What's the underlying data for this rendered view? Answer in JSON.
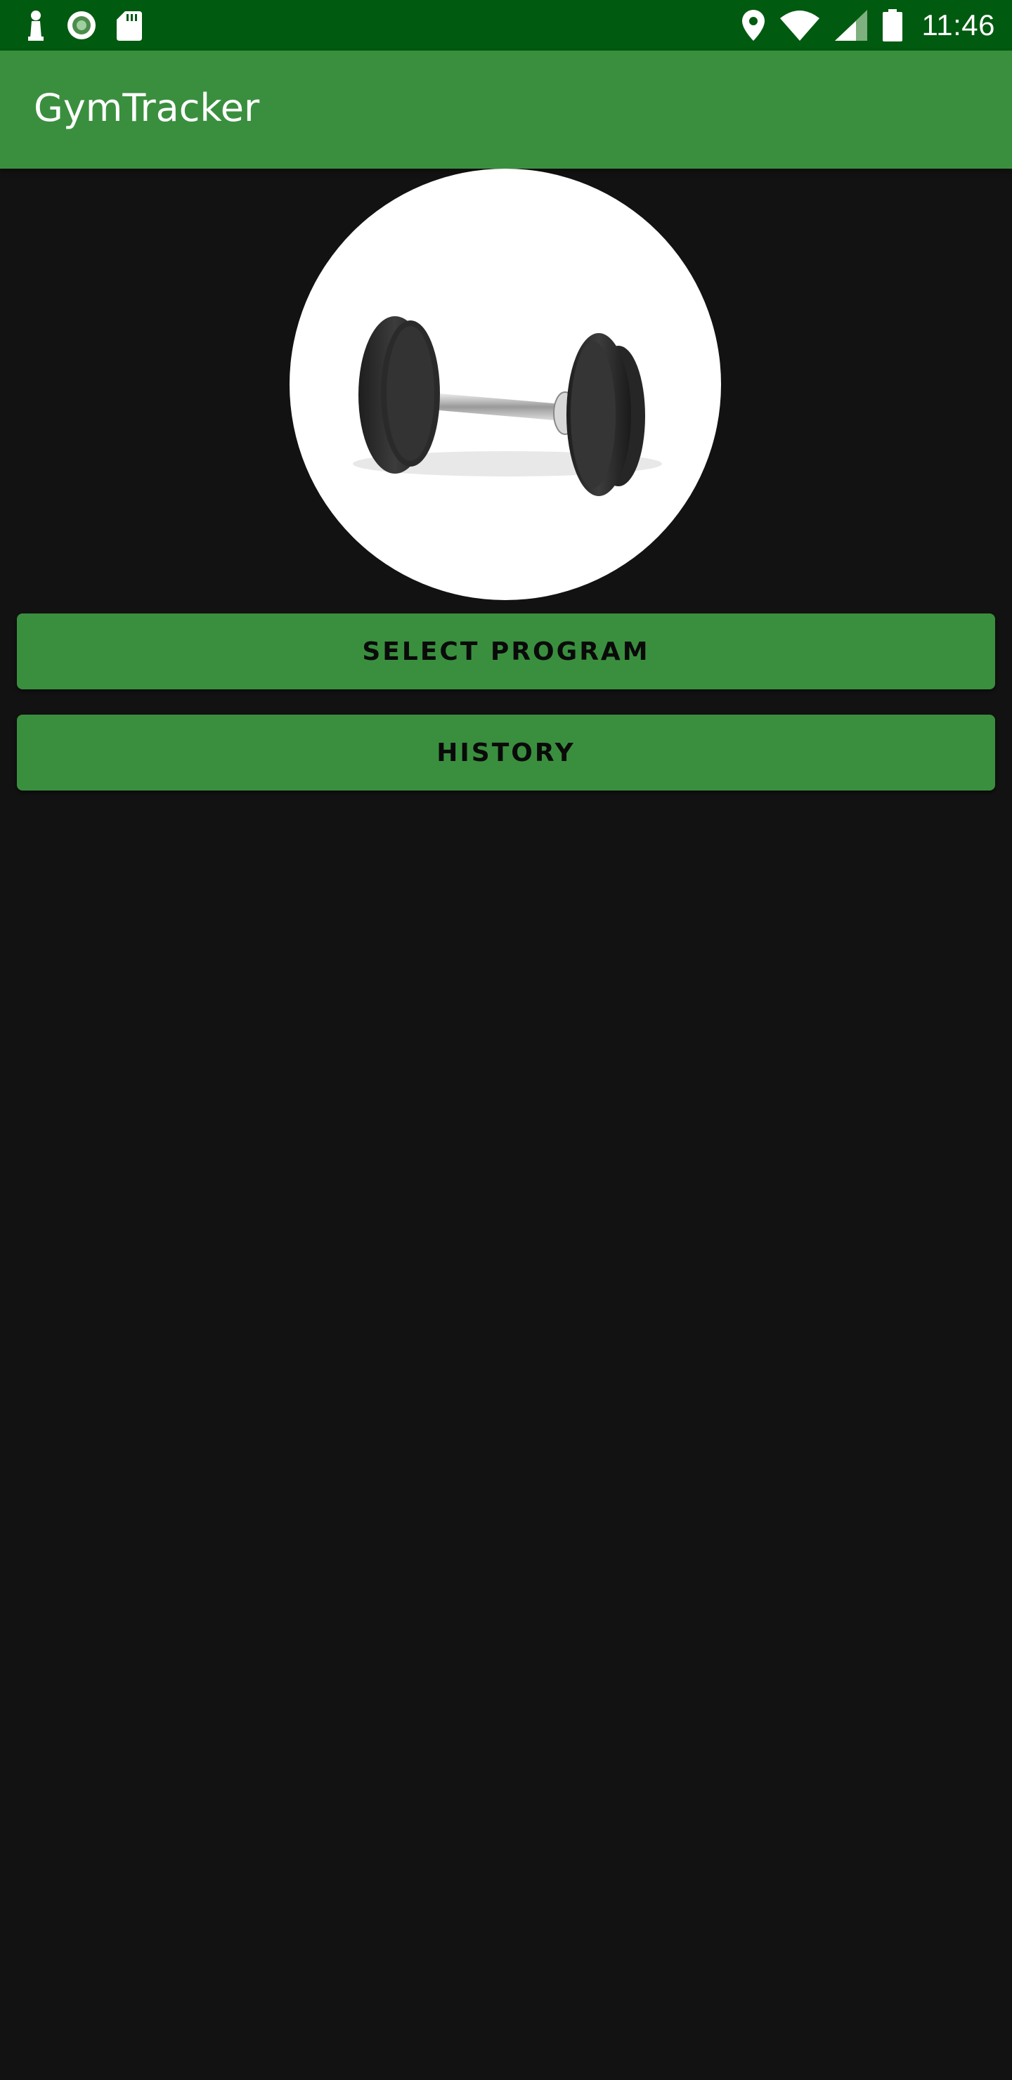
{
  "status_bar": {
    "time": "11:46",
    "left_icons": [
      "chess-pawn-icon",
      "radio-record-icon",
      "sd-card-icon"
    ],
    "right_icons": [
      "location-pin-icon",
      "wifi-icon",
      "cell-signal-icon",
      "battery-icon"
    ]
  },
  "app_bar": {
    "title": "GymTracker"
  },
  "hero": {
    "image": "dumbbell-image"
  },
  "buttons": {
    "select_program": "SELECT PROGRAM",
    "history": "HISTORY"
  },
  "colors": {
    "status_bar": "#005a10",
    "primary": "#3a8f3e",
    "background": "#121212",
    "button_text": "#0a0a0a"
  }
}
